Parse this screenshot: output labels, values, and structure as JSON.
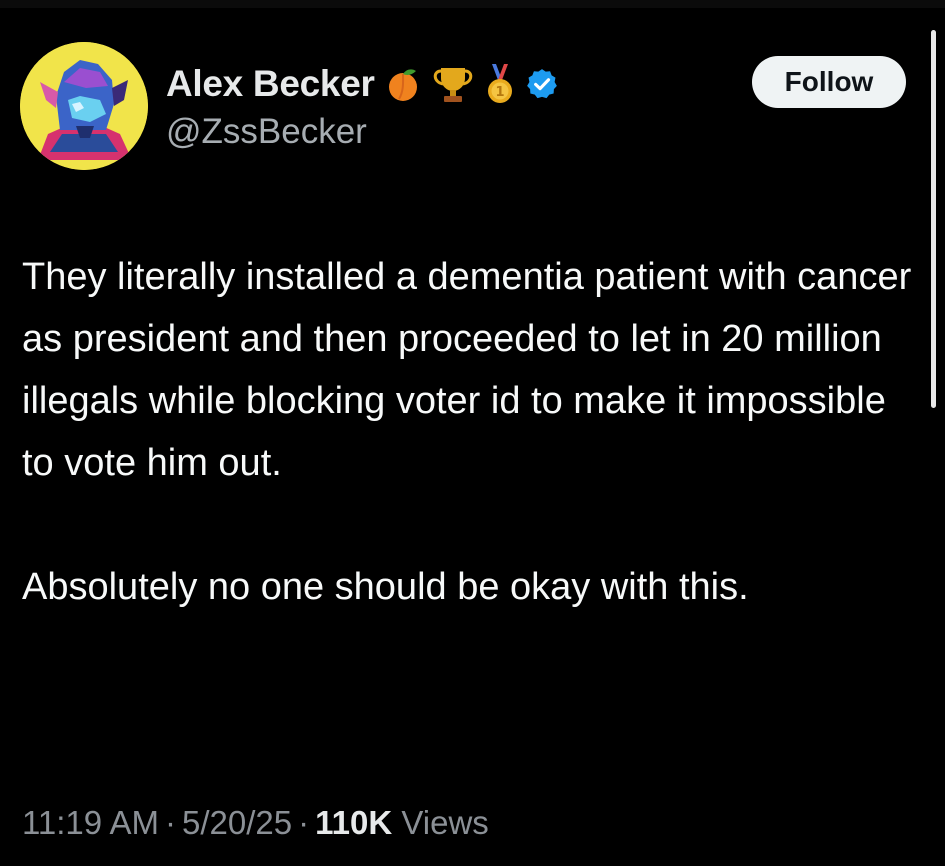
{
  "author": {
    "display_name": "Alex Becker",
    "handle": "@ZssBecker",
    "badges": [
      "peach-emoji",
      "trophy-emoji",
      "first-place-medal-emoji",
      "verified-badge"
    ]
  },
  "actions": {
    "follow_label": "Follow"
  },
  "tweet": {
    "paragraph_1": "They literally installed a dementia patient with cancer as president and then proceeded to let in 20 million illegals while blocking voter id to make it impossible to vote him out.",
    "paragraph_2": "Absolutely no one should be okay with this."
  },
  "meta": {
    "time": "11:19 AM",
    "separator": "·",
    "date": "5/20/25",
    "views_count": "110K",
    "views_label": "Views"
  },
  "colors": {
    "background": "#000000",
    "text_primary": "#e7e9ea",
    "text_secondary": "#8b9096",
    "verified_blue": "#1d9bf0",
    "button_bg": "#eff3f4"
  }
}
